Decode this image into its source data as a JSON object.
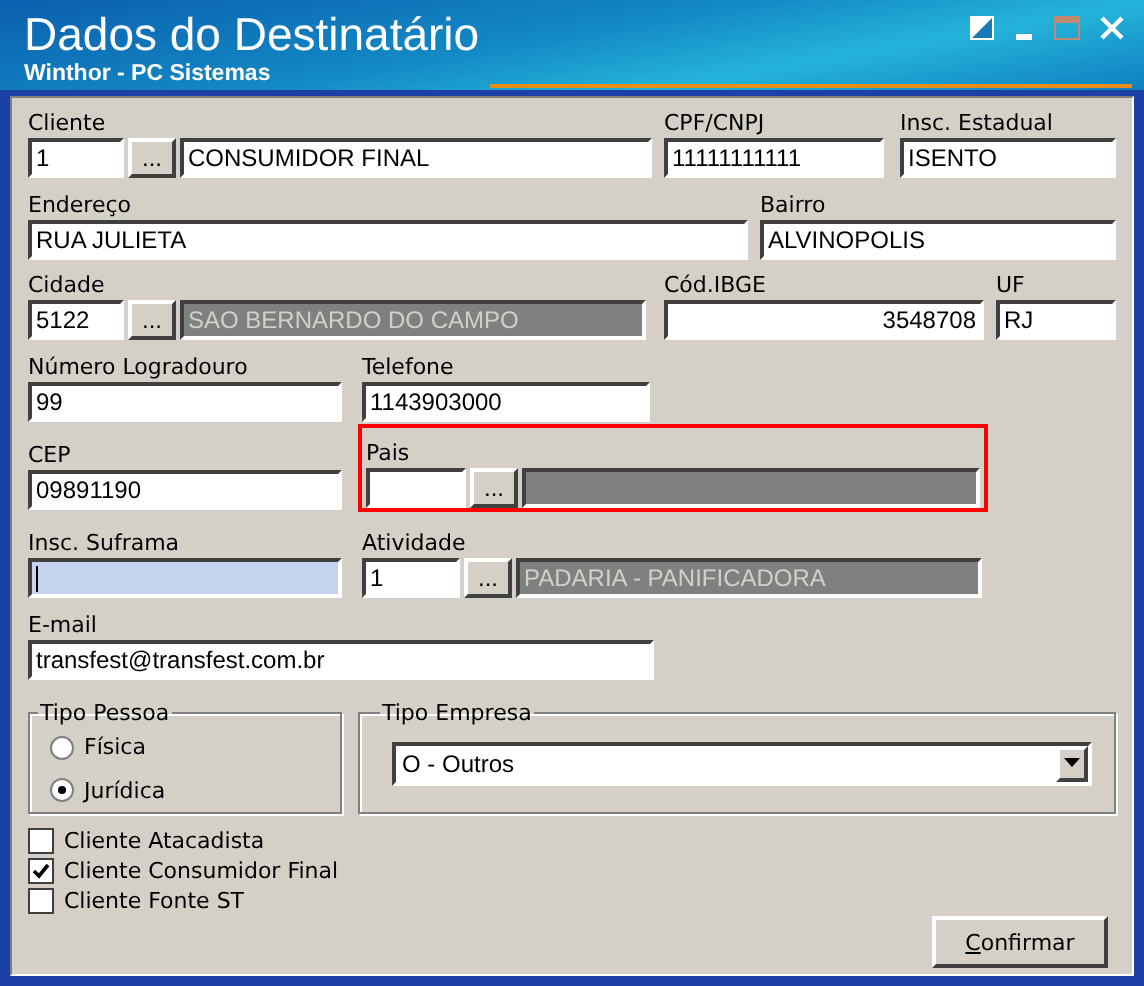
{
  "window": {
    "title": "Dados do Destinatário",
    "subtitle": "Winthor - PC Sistemas"
  },
  "rows": [
    [
      {
        "kind": "lookup",
        "label": "Cliente",
        "button": "...",
        "code": "1",
        "name": "CONSUMIDOR FINAL",
        "name_readonly": false
      },
      {
        "kind": "text",
        "label": "CPF/CNPJ",
        "value": "11111111111"
      },
      {
        "kind": "text",
        "label": "Insc. Estadual",
        "value": "ISENTO"
      }
    ],
    [
      {
        "kind": "text",
        "label": "Endereço",
        "value": "RUA JULIETA"
      },
      {
        "kind": "text",
        "label": "Bairro",
        "value": "ALVINOPOLIS"
      }
    ],
    [
      {
        "kind": "lookup",
        "label": "Cidade",
        "button": "...",
        "code": "5122",
        "name": "SAO BERNARDO DO CAMPO",
        "name_readonly": true
      },
      {
        "kind": "text",
        "label": "Cód.IBGE",
        "value": "3548708",
        "align_right": true
      },
      {
        "kind": "text",
        "label": "UF",
        "value": "RJ"
      }
    ],
    [
      {
        "kind": "text",
        "label": "Número Logradouro",
        "value": "99"
      },
      {
        "kind": "text",
        "label": "Telefone",
        "value": "1143903000"
      }
    ],
    [
      {
        "kind": "text",
        "label": "CEP",
        "value": "09891190"
      },
      {
        "kind": "lookup",
        "label": "Pais",
        "button": "...",
        "name_readonly": true,
        "highlighted": true
      }
    ],
    [
      {
        "kind": "text",
        "label": "Insc. Suframa",
        "focused": true
      },
      {
        "kind": "lookup",
        "label": "Atividade",
        "button": "...",
        "code": "1",
        "name": "PADARIA - PANIFICADORA",
        "name_readonly": true
      }
    ],
    [
      {
        "kind": "text",
        "label": "E-mail",
        "value": "transfest@transfest.com.br"
      }
    ]
  ],
  "tipo_pessoa": {
    "title": "Tipo Pessoa",
    "options": [
      {
        "label": "Física",
        "selected": false
      },
      {
        "label": "Jurídica",
        "selected": true
      }
    ]
  },
  "tipo_empresa": {
    "title": "Tipo Empresa",
    "value": "O - Outros"
  },
  "checkboxes": [
    {
      "label": "Cliente Atacadista",
      "checked": false
    },
    {
      "label": "Cliente Consumidor Final",
      "checked": true
    },
    {
      "label": "Cliente Fonte ST",
      "checked": false
    }
  ],
  "buttons": [
    {
      "label": "Confirmar"
    }
  ]
}
